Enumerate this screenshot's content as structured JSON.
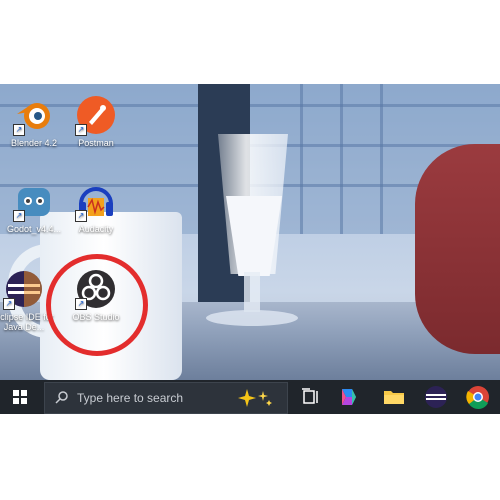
{
  "desktop": {
    "icons": [
      {
        "label": "Blender 4.2",
        "icon": "blender-icon"
      },
      {
        "label": "Postman",
        "icon": "postman-icon"
      },
      {
        "label": "Godot_v4.4...",
        "icon": "godot-icon"
      },
      {
        "label": "Audacity",
        "icon": "audacity-icon"
      },
      {
        "label": "Eclipse IDE for Java De...",
        "icon": "eclipse-icon"
      },
      {
        "label": "OBS Studio",
        "icon": "obs-icon"
      }
    ]
  },
  "taskbar": {
    "search_placeholder": "Type here to search",
    "apps": [
      "task-view-icon",
      "copilot-icon",
      "file-explorer-icon",
      "eclipse-icon",
      "chrome-icon"
    ]
  },
  "colors": {
    "highlight": "#e32d2d",
    "taskbar_bg": "#20252b",
    "search_bg": "#2d333b"
  }
}
